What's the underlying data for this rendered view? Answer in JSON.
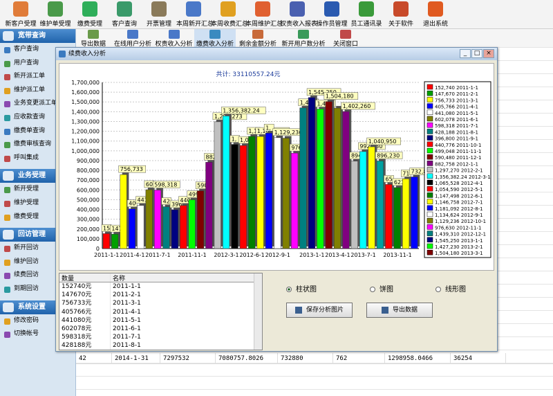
{
  "toolbar": [
    {
      "label": "新客户受理",
      "icon": "person-icon",
      "color": "#e07c3a"
    },
    {
      "label": "维护单受理",
      "icon": "edit-icon",
      "color": "#4a9a4a"
    },
    {
      "label": "缴费受理",
      "icon": "heart-icon",
      "color": "#2fae5a"
    },
    {
      "label": "客户查询",
      "icon": "person-search-icon",
      "color": "#3a9a6a"
    },
    {
      "label": "开票管理",
      "icon": "invoice-icon",
      "color": "#8a7a5a"
    },
    {
      "label": "本周新开汇总",
      "icon": "bar-chart-icon",
      "color": "#4a78c8"
    },
    {
      "label": "本周收费汇总",
      "icon": "medal-icon",
      "color": "#e0a020"
    },
    {
      "label": "本周维护汇总",
      "icon": "pie-chart-icon",
      "color": "#e06030"
    },
    {
      "label": "权责收入报表",
      "icon": "report-icon",
      "color": "#4a60b0"
    },
    {
      "label": "操作员管理",
      "icon": "monitor-icon",
      "color": "#2a5ab0"
    },
    {
      "label": "员工通讯录",
      "icon": "table-icon",
      "color": "#3a9a3a"
    },
    {
      "label": "关于软件",
      "icon": "home-icon",
      "color": "#c84a2a"
    },
    {
      "label": "退出系统",
      "icon": "power-icon",
      "color": "#e05a20"
    }
  ],
  "subtoolbar": [
    "导出数据",
    "在线用户分析",
    "权责收入分析",
    "缴费收入分析",
    "剩余金额分析",
    "新开用户数分析",
    "关闭窗口"
  ],
  "sidebar": {
    "sections": [
      {
        "title": "宽带查询",
        "items": [
          "客户查询",
          "用户查询",
          "新开派工单",
          "维护派工单",
          "业务变更派工单",
          "应收款查询",
          "缴费单查询",
          "缴费审核查询",
          "呼叫集成"
        ]
      },
      {
        "title": "业务受理",
        "items": [
          "新开受理",
          "维护受理",
          "缴费受理"
        ]
      },
      {
        "title": "回访管理",
        "items": [
          "新开回访",
          "维护回访",
          "续费回访",
          "到期回访"
        ]
      },
      {
        "title": "系统设置",
        "items": [
          "修改密码",
          "切换帐号"
        ]
      }
    ]
  },
  "window": {
    "title": "续费收入分析",
    "buttons": {
      "minimize": "_",
      "maximize": "□",
      "close": "×"
    }
  },
  "chart_data": {
    "type": "bar",
    "title": "共计: 33110557.24元",
    "ylim": [
      0,
      1700000
    ],
    "yticks": [
      "0",
      "100,000",
      "200,000",
      "300,000",
      "400,000",
      "500,000",
      "600,000",
      "700,000",
      "800,000",
      "900,000",
      "1,000,000",
      "1,100,000",
      "1,200,000",
      "1,300,000",
      "1,400,000",
      "1,500,000",
      "1,600,000",
      "1,700,000"
    ],
    "xticks": [
      "2011-1-1",
      "2011-4-1",
      "2011-7-1",
      "2011-11-1",
      "2012-3-1",
      "2012-6-1",
      "2012-9-1",
      "2013-1-1",
      "2013-4-1",
      "2013-7-1",
      "2013-11-1"
    ],
    "categories": [
      "2011-1-1",
      "2011-2-1",
      "2011-3-1",
      "2011-4-1",
      "2011-5-1",
      "2011-6-1",
      "2011-7-1",
      "2011-8-1",
      "2011-9-1",
      "2011-10-1",
      "2011-11-1",
      "2011-12-1",
      "2012-1-1",
      "2012-2-1",
      "2012-3-1",
      "2012-4-1",
      "2012-5-1",
      "2012-6-1",
      "2012-7-1",
      "2012-8-1",
      "2012-9-1",
      "2012-10-1",
      "2012-11-1",
      "2012-12-1",
      "2013-1-1",
      "2013-2-1",
      "2013-3-1",
      "2013-4-1",
      "2013-5-1",
      "2013-6-1",
      "2013-7-1",
      "2013-8-1",
      "2013-9-1",
      "2013-10-1",
      "2013-11-1",
      "2013-12-1",
      "2014-1-1"
    ],
    "values": [
      152740,
      147670,
      756733,
      405766,
      441080,
      602078,
      598318,
      428188,
      396800,
      440776,
      499048,
      590480,
      882758,
      1297270,
      1356382.24,
      1065528,
      1054590,
      1147498,
      1146758,
      1181092,
      1134624,
      1129236,
      976630,
      1439310,
      1545250,
      1427230,
      1504180,
      1437530,
      1402260,
      894410,
      992130,
      1040950,
      896230,
      656000,
      623820,
      713000,
      732880
    ],
    "bar_labels": [
      "15",
      "147,670",
      "756,733",
      "40",
      "441,080",
      "60",
      "598,318",
      "42",
      "396,800",
      "440,776",
      "499,048",
      "590,480",
      "882,758",
      "1,297,273",
      "1,356,382.24",
      "1,",
      "1,054,590",
      "1,1",
      "1,181,092",
      "1,",
      "1,129,236",
      "",
      "976,630",
      "1,439",
      "1,545,250",
      "1,427",
      "1,504,180",
      "",
      "1,402,260",
      "894,410",
      "992,130",
      "1,040,950",
      "896,230",
      "65",
      "623,820",
      "71",
      "732,880"
    ],
    "legend": [
      "152,740 2011-1-1",
      "147,670 2011-2-1",
      "756,733 2011-3-1",
      "405,766 2011-4-1",
      "441,080 2011-5-1",
      "602,078 2011-6-1",
      "598,318 2011-7-1",
      "428,188 2011-8-1",
      "396,800 2011-9-1",
      "440,776 2011-10-1",
      "499,048 2011-11-1",
      "590,480 2011-12-1",
      "882,758 2012-1-1",
      "1,297,270 2012-2-1",
      "1,356,382.24 2012-3-1",
      "1,065,528 2012-4-1",
      "1,054,590 2012-5-1",
      "1,147,498 2012-6-1",
      "1,146,758 2012-7-1",
      "1,181,092 2012-8-1",
      "1,134,624 2012-9-1",
      "1,129,236 2012-10-1",
      "976,630 2012-11-1",
      "1,439,310 2012-12-1",
      "1,545,250 2013-1-1",
      "1,427,230 2013-2-1",
      "1,504,180 2013-3-1"
    ],
    "colors": [
      "#ff0000",
      "#00a000",
      "#ffff00",
      "#0000ff",
      "#ffffff",
      "#808000",
      "#ff00ff",
      "#008080",
      "#000080",
      "#ff0000",
      "#00ff00",
      "#800000",
      "#800080",
      "#c0c0c0",
      "#00ffff",
      "#000000",
      "#ff0000",
      "#008000",
      "#ffff00",
      "#0000ff",
      "#ffffff",
      "#808000",
      "#ff00ff",
      "#008080",
      "#000080",
      "#00ff00",
      "#800000",
      "#808000",
      "#800080",
      "#c0c0c0",
      "#00ffff",
      "#ffff00",
      "#00a0a0",
      "#ff0000",
      "#008000",
      "#ffff00",
      "#0000ff"
    ],
    "legend_placement": "right",
    "grid": true
  },
  "table": {
    "headers": [
      "数量",
      "名称"
    ],
    "rows": [
      [
        "152740元",
        "2011-1-1"
      ],
      [
        "147670元",
        "2011-2-1"
      ],
      [
        "756733元",
        "2011-3-1"
      ],
      [
        "405766元",
        "2011-4-1"
      ],
      [
        "441080元",
        "2011-5-1"
      ],
      [
        "602078元",
        "2011-6-1"
      ],
      [
        "598318元",
        "2011-7-1"
      ],
      [
        "428188元",
        "2011-8-1"
      ]
    ]
  },
  "options": {
    "radios": [
      "柱状图",
      "饼图",
      "线形图"
    ],
    "selected": "柱状图",
    "save_label": "保存分析图片",
    "export_label": "导出数据"
  },
  "background_row": [
    "42",
    "2014-1-31",
    "7297532",
    "7080757.8026",
    "732880",
    "762",
    "1298958.0466",
    "36254"
  ]
}
